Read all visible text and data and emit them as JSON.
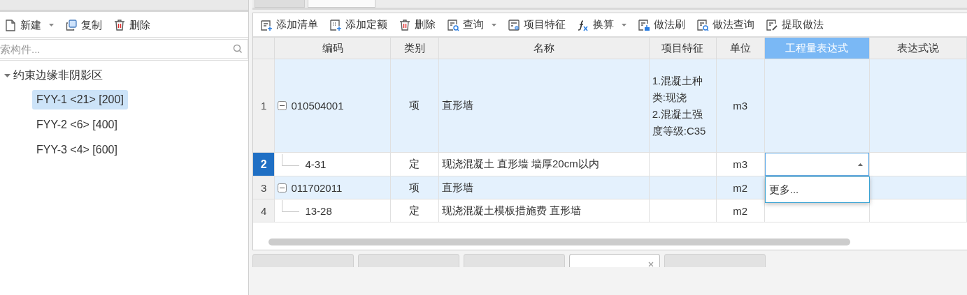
{
  "left_panel": {
    "toolbar": [
      {
        "kind": "new",
        "label": "新建",
        "dropdown": true
      },
      {
        "kind": "copy",
        "label": "复制",
        "dropdown": false
      },
      {
        "kind": "delete",
        "label": "删除",
        "dropdown": false
      }
    ],
    "search": {
      "placeholder": "索构件..."
    },
    "tree": [
      {
        "label": "约束边缘非阴影区",
        "expanded": true,
        "children": [
          {
            "label": "FYY-1 <21> [200]",
            "selected": true
          },
          {
            "label": "FYY-2 <6> [400]",
            "selected": false
          },
          {
            "label": "FYY-3 <4> [600]",
            "selected": false
          }
        ]
      }
    ]
  },
  "top_tabs": [
    {
      "selected": false
    },
    {
      "selected": true
    }
  ],
  "toolbar": [
    {
      "kind": "add-list",
      "label": "添加清单",
      "dropdown": false
    },
    {
      "kind": "add-quota",
      "label": "添加定额",
      "dropdown": false
    },
    {
      "kind": "delete",
      "label": "删除",
      "dropdown": false
    },
    {
      "kind": "query",
      "label": "查询",
      "dropdown": true
    },
    {
      "kind": "feature",
      "label": "项目特征",
      "dropdown": false
    },
    {
      "kind": "fx",
      "label": "换算",
      "dropdown": true
    },
    {
      "kind": "brush",
      "label": "做法刷",
      "dropdown": false
    },
    {
      "kind": "query",
      "label": "做法查询",
      "dropdown": false
    },
    {
      "kind": "extract",
      "label": "提取做法",
      "dropdown": false
    }
  ],
  "table": {
    "columns": [
      {
        "label": "编码",
        "selected": false
      },
      {
        "label": "类别",
        "selected": false
      },
      {
        "label": "名称",
        "selected": false
      },
      {
        "label": "项目特征",
        "selected": false
      },
      {
        "label": "单位",
        "selected": false
      },
      {
        "label": "工程量表达式",
        "selected": true
      },
      {
        "label": "表达式说",
        "selected": false
      }
    ],
    "rows": [
      {
        "number": "1",
        "selected": false,
        "kind": "item",
        "expanded": true,
        "code": "010504001",
        "category": "项",
        "name": "直形墙",
        "features": "1.混凝土种类:现浇\n2.混凝土强度等级:C35",
        "unit": "m3"
      },
      {
        "number": "2",
        "selected": true,
        "kind": "quota",
        "code": "4-31",
        "category": "定",
        "name": "现浇混凝土 直形墙 墙厚20cm以内",
        "features": "",
        "unit": "m3",
        "editor": {
          "open": true,
          "options": [
            "更多..."
          ]
        }
      },
      {
        "number": "3",
        "selected": false,
        "kind": "item",
        "expanded": true,
        "code": "011702011",
        "category": "项",
        "name": "直形墙",
        "features": "",
        "unit": "m2"
      },
      {
        "number": "4",
        "selected": false,
        "kind": "quota",
        "code": "13-28",
        "category": "定",
        "name": "现浇混凝土模板措施费 直形墙",
        "features": "",
        "unit": "m2"
      }
    ]
  },
  "bottom_tabs": [
    {
      "selected": false
    },
    {
      "selected": false
    },
    {
      "selected": false
    },
    {
      "selected": true,
      "closable": true
    },
    {
      "selected": false
    }
  ]
}
